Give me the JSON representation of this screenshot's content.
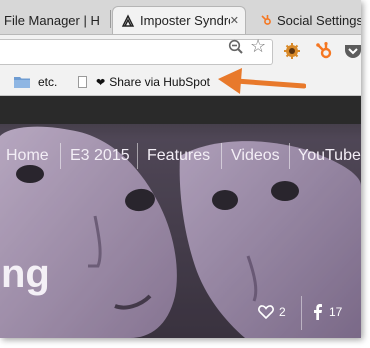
{
  "tabs": [
    {
      "title": "File Manager | H"
    },
    {
      "title": "Imposter Syndro"
    },
    {
      "title": "Social Settings"
    }
  ],
  "bookmarks": [
    {
      "label": "etc.",
      "icon": "folder-icon"
    },
    {
      "label": "Share via HubSpot",
      "icon": "page-icon",
      "prefix": "❤"
    }
  ],
  "site": {
    "nav": [
      "Home",
      "E3 2015",
      "Features",
      "Videos",
      "YouTube"
    ],
    "hero_heading": "ng",
    "likes_count": "2",
    "facebook_count": "17"
  },
  "colors": {
    "arrow": "#e8792b",
    "hubspot": "#f57722",
    "hero_tint": "#7a6a86"
  }
}
